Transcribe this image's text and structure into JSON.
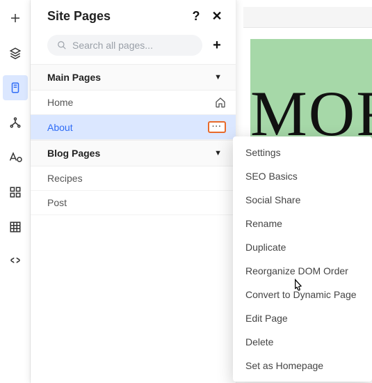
{
  "leftRail": {
    "items": [
      {
        "name": "add-icon"
      },
      {
        "name": "layers-icon"
      },
      {
        "name": "pages-icon",
        "selected": true
      },
      {
        "name": "connections-icon"
      },
      {
        "name": "styles-icon"
      },
      {
        "name": "apps-icon"
      },
      {
        "name": "grid-icon"
      },
      {
        "name": "code-icon"
      }
    ]
  },
  "panel": {
    "title": "Site Pages",
    "search": {
      "placeholder": "Search all pages..."
    },
    "sections": [
      {
        "title": "Main Pages",
        "pages": [
          {
            "label": "Home",
            "trailing": "home-icon"
          },
          {
            "label": "About",
            "trailing": "more-icon",
            "selected": true
          }
        ]
      },
      {
        "title": "Blog Pages",
        "pages": [
          {
            "label": "Recipes"
          },
          {
            "label": "Post"
          }
        ]
      }
    ]
  },
  "canvas": {
    "headline": "MOR"
  },
  "contextMenu": {
    "items": [
      "Settings",
      "SEO Basics",
      "Social Share",
      "Rename",
      "Duplicate",
      "Reorganize DOM Order",
      "Convert to Dynamic Page",
      "Edit Page",
      "Delete",
      "Set as Homepage"
    ]
  }
}
